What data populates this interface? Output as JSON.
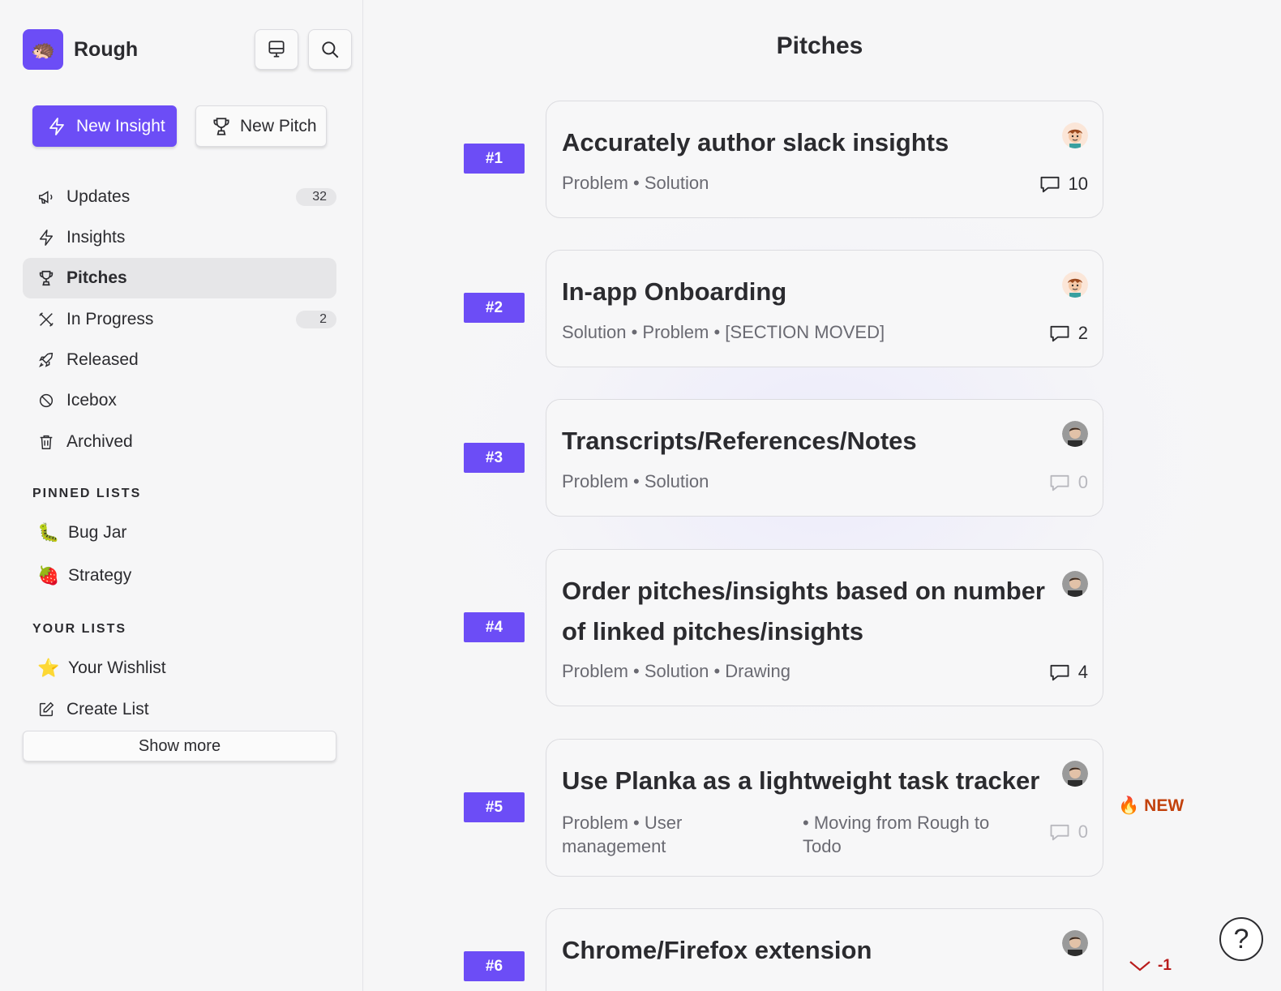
{
  "app": {
    "name": "Rough",
    "logo_icon": "hedgehog-icon",
    "accent": "#6c4df6"
  },
  "toolbar": {
    "new_insight": "New Insight",
    "new_pitch": "New Pitch"
  },
  "nav": [
    {
      "label": "Updates",
      "icon": "megaphone-icon",
      "count": "32"
    },
    {
      "label": "Insights",
      "icon": "bolt-icon"
    },
    {
      "label": "Pitches",
      "icon": "trophy-icon",
      "active": true
    },
    {
      "label": "In Progress",
      "icon": "tools-icon",
      "count": "2"
    },
    {
      "label": "Released",
      "icon": "rocket-icon"
    },
    {
      "label": "Icebox",
      "icon": "ban-icon"
    },
    {
      "label": "Archived",
      "icon": "trash-icon"
    }
  ],
  "pinned": {
    "title": "PINNED LISTS",
    "items": [
      {
        "label": "Bug Jar",
        "emoji": "🐛"
      },
      {
        "label": "Strategy",
        "emoji": "🍓"
      }
    ]
  },
  "your_lists": {
    "title": "YOUR LISTS",
    "items": [
      {
        "label": "Your Wishlist",
        "emoji": "⭐"
      },
      {
        "label": "Create List",
        "icon": "edit-icon"
      }
    ]
  },
  "show_more": "Show more",
  "main": {
    "title": "Pitches",
    "pitches": [
      {
        "rank": "#1",
        "title": "Accurately author slack insights",
        "sections": "Problem • Solution",
        "comments": "10"
      },
      {
        "rank": "#2",
        "title": "In-app Onboarding",
        "sections": "Solution • Problem • [SECTION MOVED]",
        "comments": "2"
      },
      {
        "rank": "#3",
        "title": "Transcripts/References/Notes",
        "sections": "Problem • Solution",
        "comments": "0"
      },
      {
        "rank": "#4",
        "title": "Order pitches/insights based on number of linked pitches/insights",
        "sections": "Problem • Solution • Drawing",
        "comments": "4"
      },
      {
        "rank": "#5",
        "title": "Use Planka as a lightweight task tracker",
        "sections_a": "Problem • User management",
        "sections_b": "• Moving from Rough to Todo",
        "comments": "0",
        "badge": "NEW"
      },
      {
        "rank": "#6",
        "title": "Chrome/Firefox extension",
        "delta": "-1"
      }
    ]
  }
}
